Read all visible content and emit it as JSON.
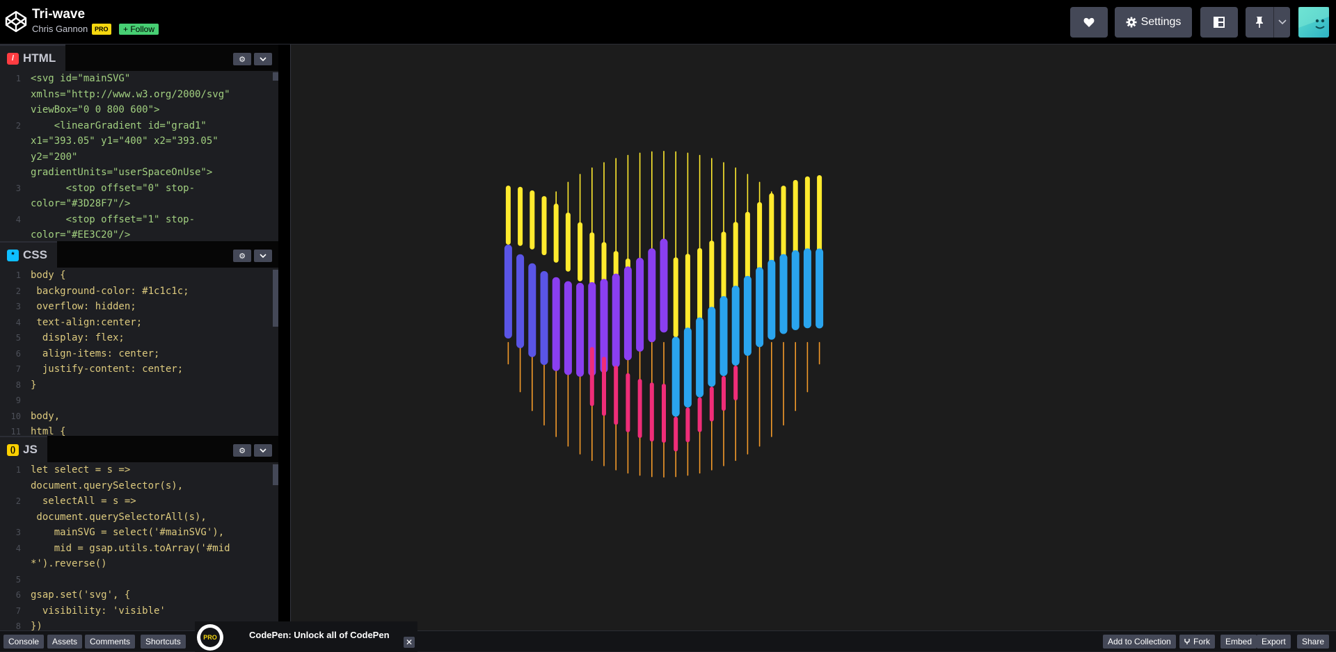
{
  "header": {
    "title": "Tri-wave",
    "author": "Chris Gannon",
    "pro_badge": "PRO",
    "follow_label": "+ Follow",
    "settings_label": "Settings"
  },
  "panels": {
    "html": {
      "label": "HTML",
      "lines": [
        {
          "n": "1",
          "text": "<svg id=\"mainSVG\""
        },
        {
          "n": "",
          "text": "xmlns=\"http://www.w3.org/2000/svg\""
        },
        {
          "n": "",
          "text": "viewBox=\"0 0 800 600\">"
        },
        {
          "n": "2",
          "text": "    <linearGradient id=\"grad1\""
        },
        {
          "n": "",
          "text": "x1=\"393.05\" y1=\"400\" x2=\"393.05\""
        },
        {
          "n": "",
          "text": "y2=\"200\""
        },
        {
          "n": "",
          "text": "gradientUnits=\"userSpaceOnUse\">"
        },
        {
          "n": "3",
          "text": "      <stop offset=\"0\" stop-"
        },
        {
          "n": "",
          "text": "color=\"#3D28F7\"/>"
        },
        {
          "n": "4",
          "text": "      <stop offset=\"1\" stop-"
        },
        {
          "n": "",
          "text": "color=\"#EE3C20\"/>"
        }
      ]
    },
    "css": {
      "label": "CSS",
      "lines": [
        {
          "n": "1",
          "text": "body {"
        },
        {
          "n": "2",
          "text": " background-color: #1c1c1c;"
        },
        {
          "n": "3",
          "text": " overflow: hidden;"
        },
        {
          "n": "4",
          "text": " text-align:center;"
        },
        {
          "n": "5",
          "text": "  display: flex;"
        },
        {
          "n": "6",
          "text": "  align-items: center;"
        },
        {
          "n": "7",
          "text": "  justify-content: center;"
        },
        {
          "n": "8",
          "text": "}"
        },
        {
          "n": "9",
          "text": ""
        },
        {
          "n": "10",
          "text": "body,"
        },
        {
          "n": "11",
          "text": "html {"
        }
      ]
    },
    "js": {
      "label": "JS",
      "lines": [
        {
          "n": "1",
          "text": "let select = s =>"
        },
        {
          "n": "",
          "text": "document.querySelector(s),"
        },
        {
          "n": "2",
          "text": "  selectAll = s =>"
        },
        {
          "n": "",
          "text": " document.querySelectorAll(s),"
        },
        {
          "n": "3",
          "text": "    mainSVG = select('#mainSVG'),"
        },
        {
          "n": "4",
          "text": "    mid = gsap.utils.toArray('#mid"
        },
        {
          "n": "",
          "text": "*').reverse()"
        },
        {
          "n": "5",
          "text": ""
        },
        {
          "n": "6",
          "text": "gsap.set('svg', {"
        },
        {
          "n": "7",
          "text": "  visibility: 'visible'"
        },
        {
          "n": "8",
          "text": "})"
        }
      ]
    }
  },
  "bottom_bar": {
    "left_buttons": [
      "Console",
      "Assets",
      "Comments",
      "Shortcuts"
    ],
    "promo_badge": "PRO",
    "promo_text": "CodePen: Unlock all of CodePen",
    "promo_close": "✕",
    "right_buttons": [
      "Add to Collection",
      "Fork",
      "Embed",
      "Export",
      "Share"
    ]
  },
  "preview": {
    "colors": {
      "background": "#1c1c1c",
      "yellow": "#ffea2e",
      "orange": "#f39a2a",
      "purple": "#8a3ff0",
      "indigo": "#5a55e6",
      "red": "#e8343a",
      "pink": "#ef2d78",
      "blue": "#2aa4ee"
    }
  }
}
